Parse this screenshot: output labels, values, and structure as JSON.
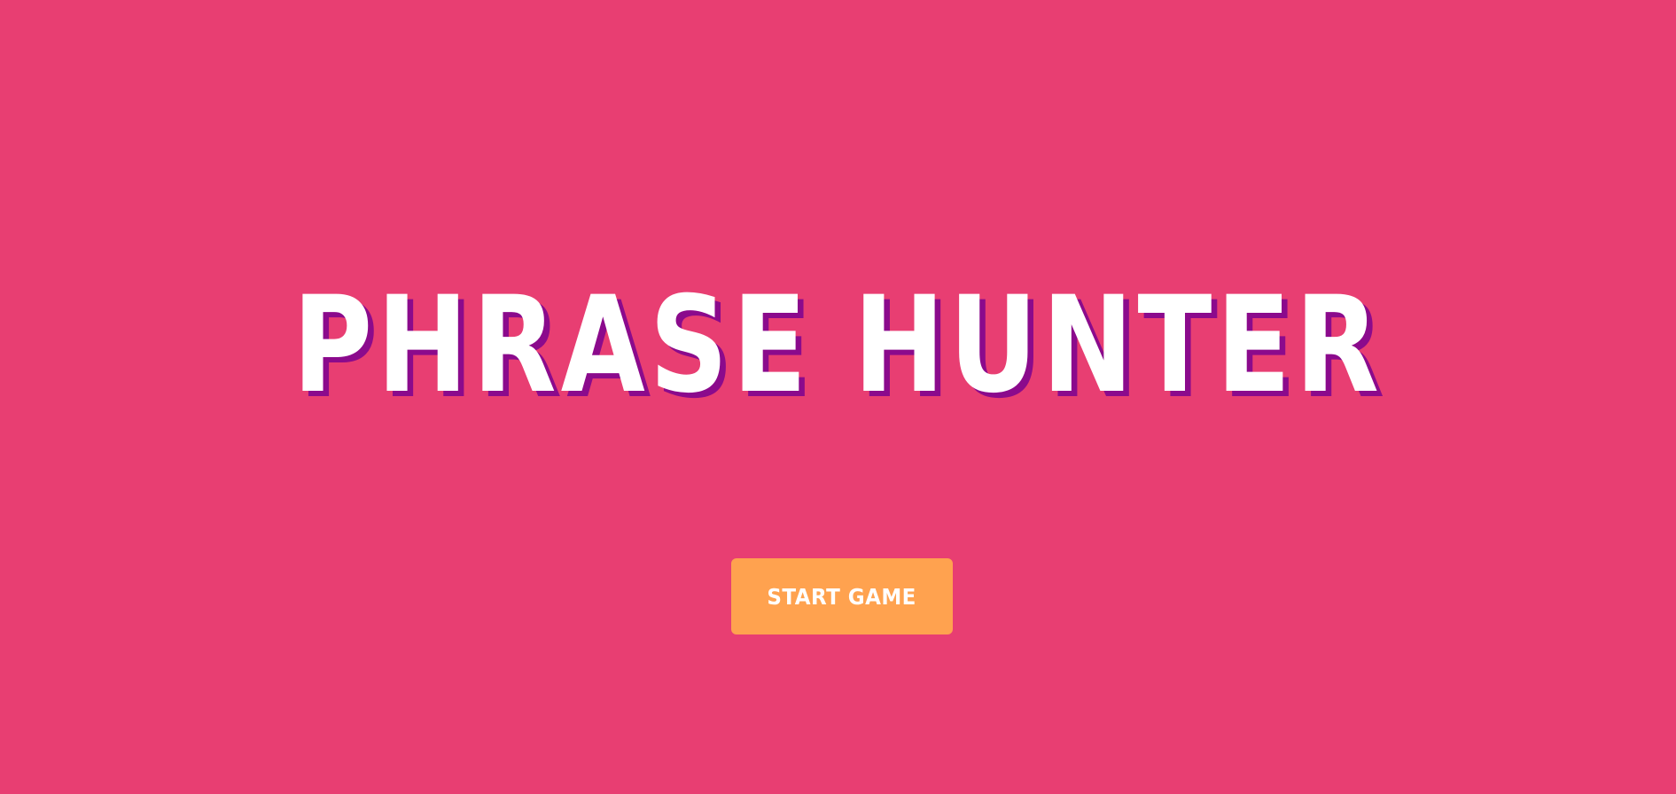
{
  "colors": {
    "background": "#e83e72",
    "title_text": "#ffffff",
    "title_shadow": "#8b0a8c",
    "button_background": "#ffa24f",
    "button_text": "#ffffff"
  },
  "overlay": {
    "title": "PHRASE HUNTER",
    "start_button_label": "START GAME"
  }
}
